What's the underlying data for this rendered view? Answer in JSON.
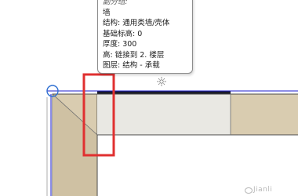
{
  "tooltip": {
    "lines": [
      "副分组:",
      "墙",
      "结构: 通用类墙/壳体",
      "基础标高: 0",
      "厚度: 300",
      "高: 链接到 2. 楼层",
      "图层: 结构 - 承载"
    ]
  },
  "colors": {
    "wall_fill": "#d9ccb0",
    "wall_highlight": "#e9e8e3",
    "selection_box": "#e03030",
    "reference_line": "#1a1acc",
    "snap_circle": "#2e6fd1"
  },
  "watermark": {
    "text": "Jianli"
  }
}
